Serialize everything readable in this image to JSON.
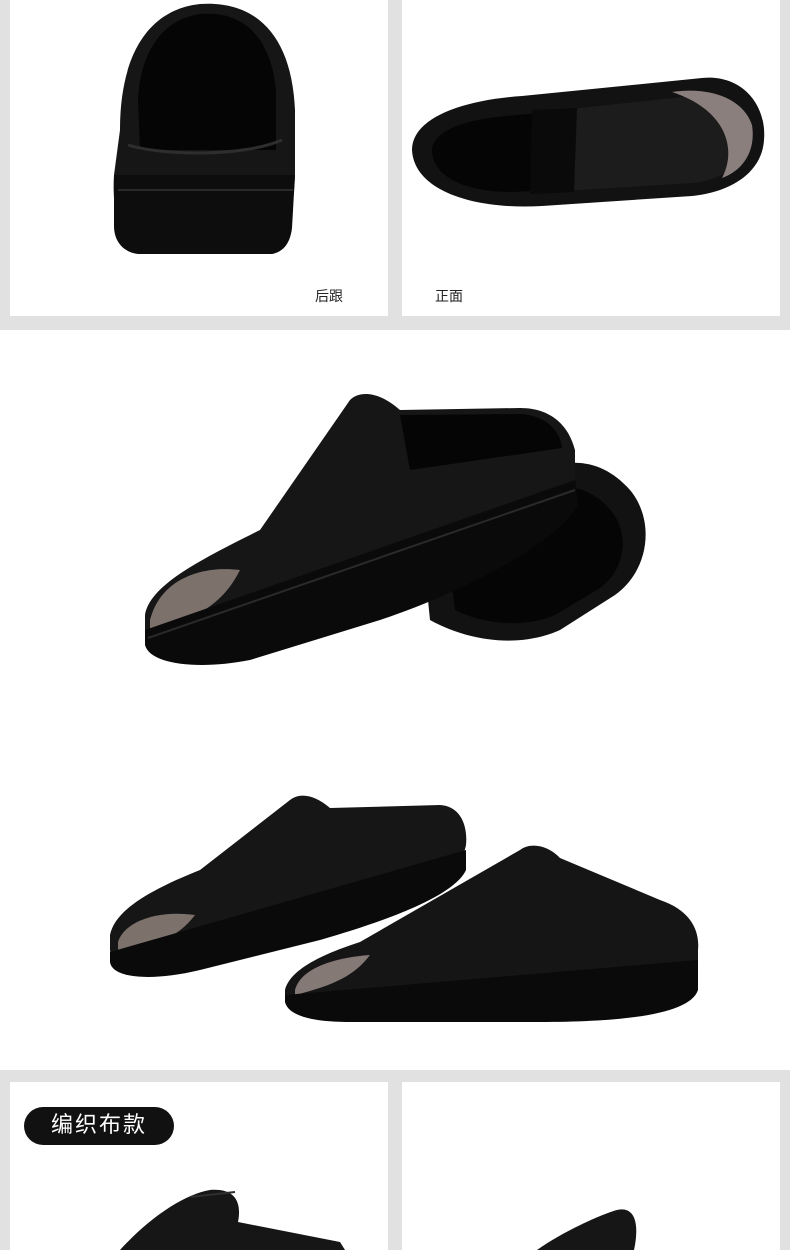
{
  "top_row": {
    "left_panel": {
      "caption": "后跟",
      "image": "shoe-heel-view"
    },
    "right_panel": {
      "caption": "正面",
      "image": "shoe-top-view"
    }
  },
  "middle_photos": [
    {
      "image": "shoe-pair-side-view"
    },
    {
      "image": "shoe-pair-front-view"
    }
  ],
  "bottom_row": {
    "tag_label": "编织布款",
    "left_panel": {
      "image": "woven-shoe-partial"
    },
    "right_panel": {
      "image": "woven-shoe-partial"
    }
  },
  "colors": {
    "band": "#e1e1e1",
    "shoe": "#141414",
    "toe_cap": "#8a7f7c",
    "tag_bg": "#111111"
  }
}
